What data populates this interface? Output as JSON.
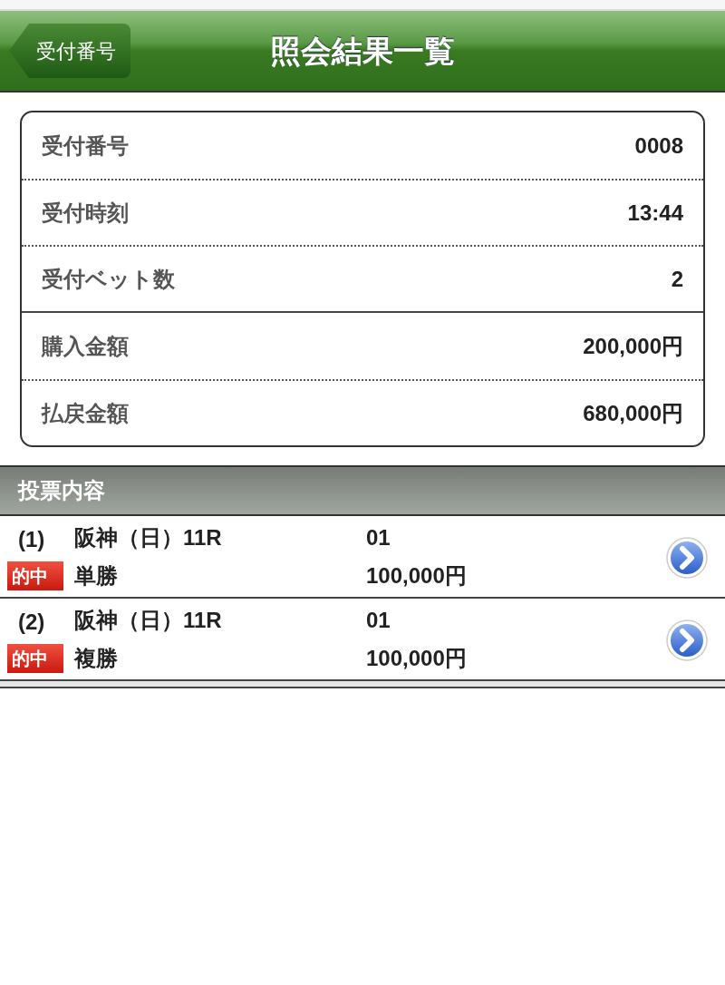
{
  "header": {
    "back_button": "受付番号",
    "title": "照会結果一覧"
  },
  "summary": {
    "groups": [
      [
        {
          "label": "受付番号",
          "value": "0008"
        },
        {
          "label": "受付時刻",
          "value": "13:44"
        },
        {
          "label": "受付ベット数",
          "value": "2"
        }
      ],
      [
        {
          "label": "購入金額",
          "value": "200,000円"
        },
        {
          "label": "払戻金額",
          "value": "680,000円"
        }
      ]
    ]
  },
  "section": {
    "title": "投票内容"
  },
  "bets": [
    {
      "number": "(1)",
      "race": "阪神（日）11R",
      "horse": "01",
      "badge": "的中",
      "bet_type": "単勝",
      "amount": "100,000円"
    },
    {
      "number": "(2)",
      "race": "阪神（日）11R",
      "horse": "01",
      "badge": "的中",
      "bet_type": "複勝",
      "amount": "100,000円"
    }
  ]
}
